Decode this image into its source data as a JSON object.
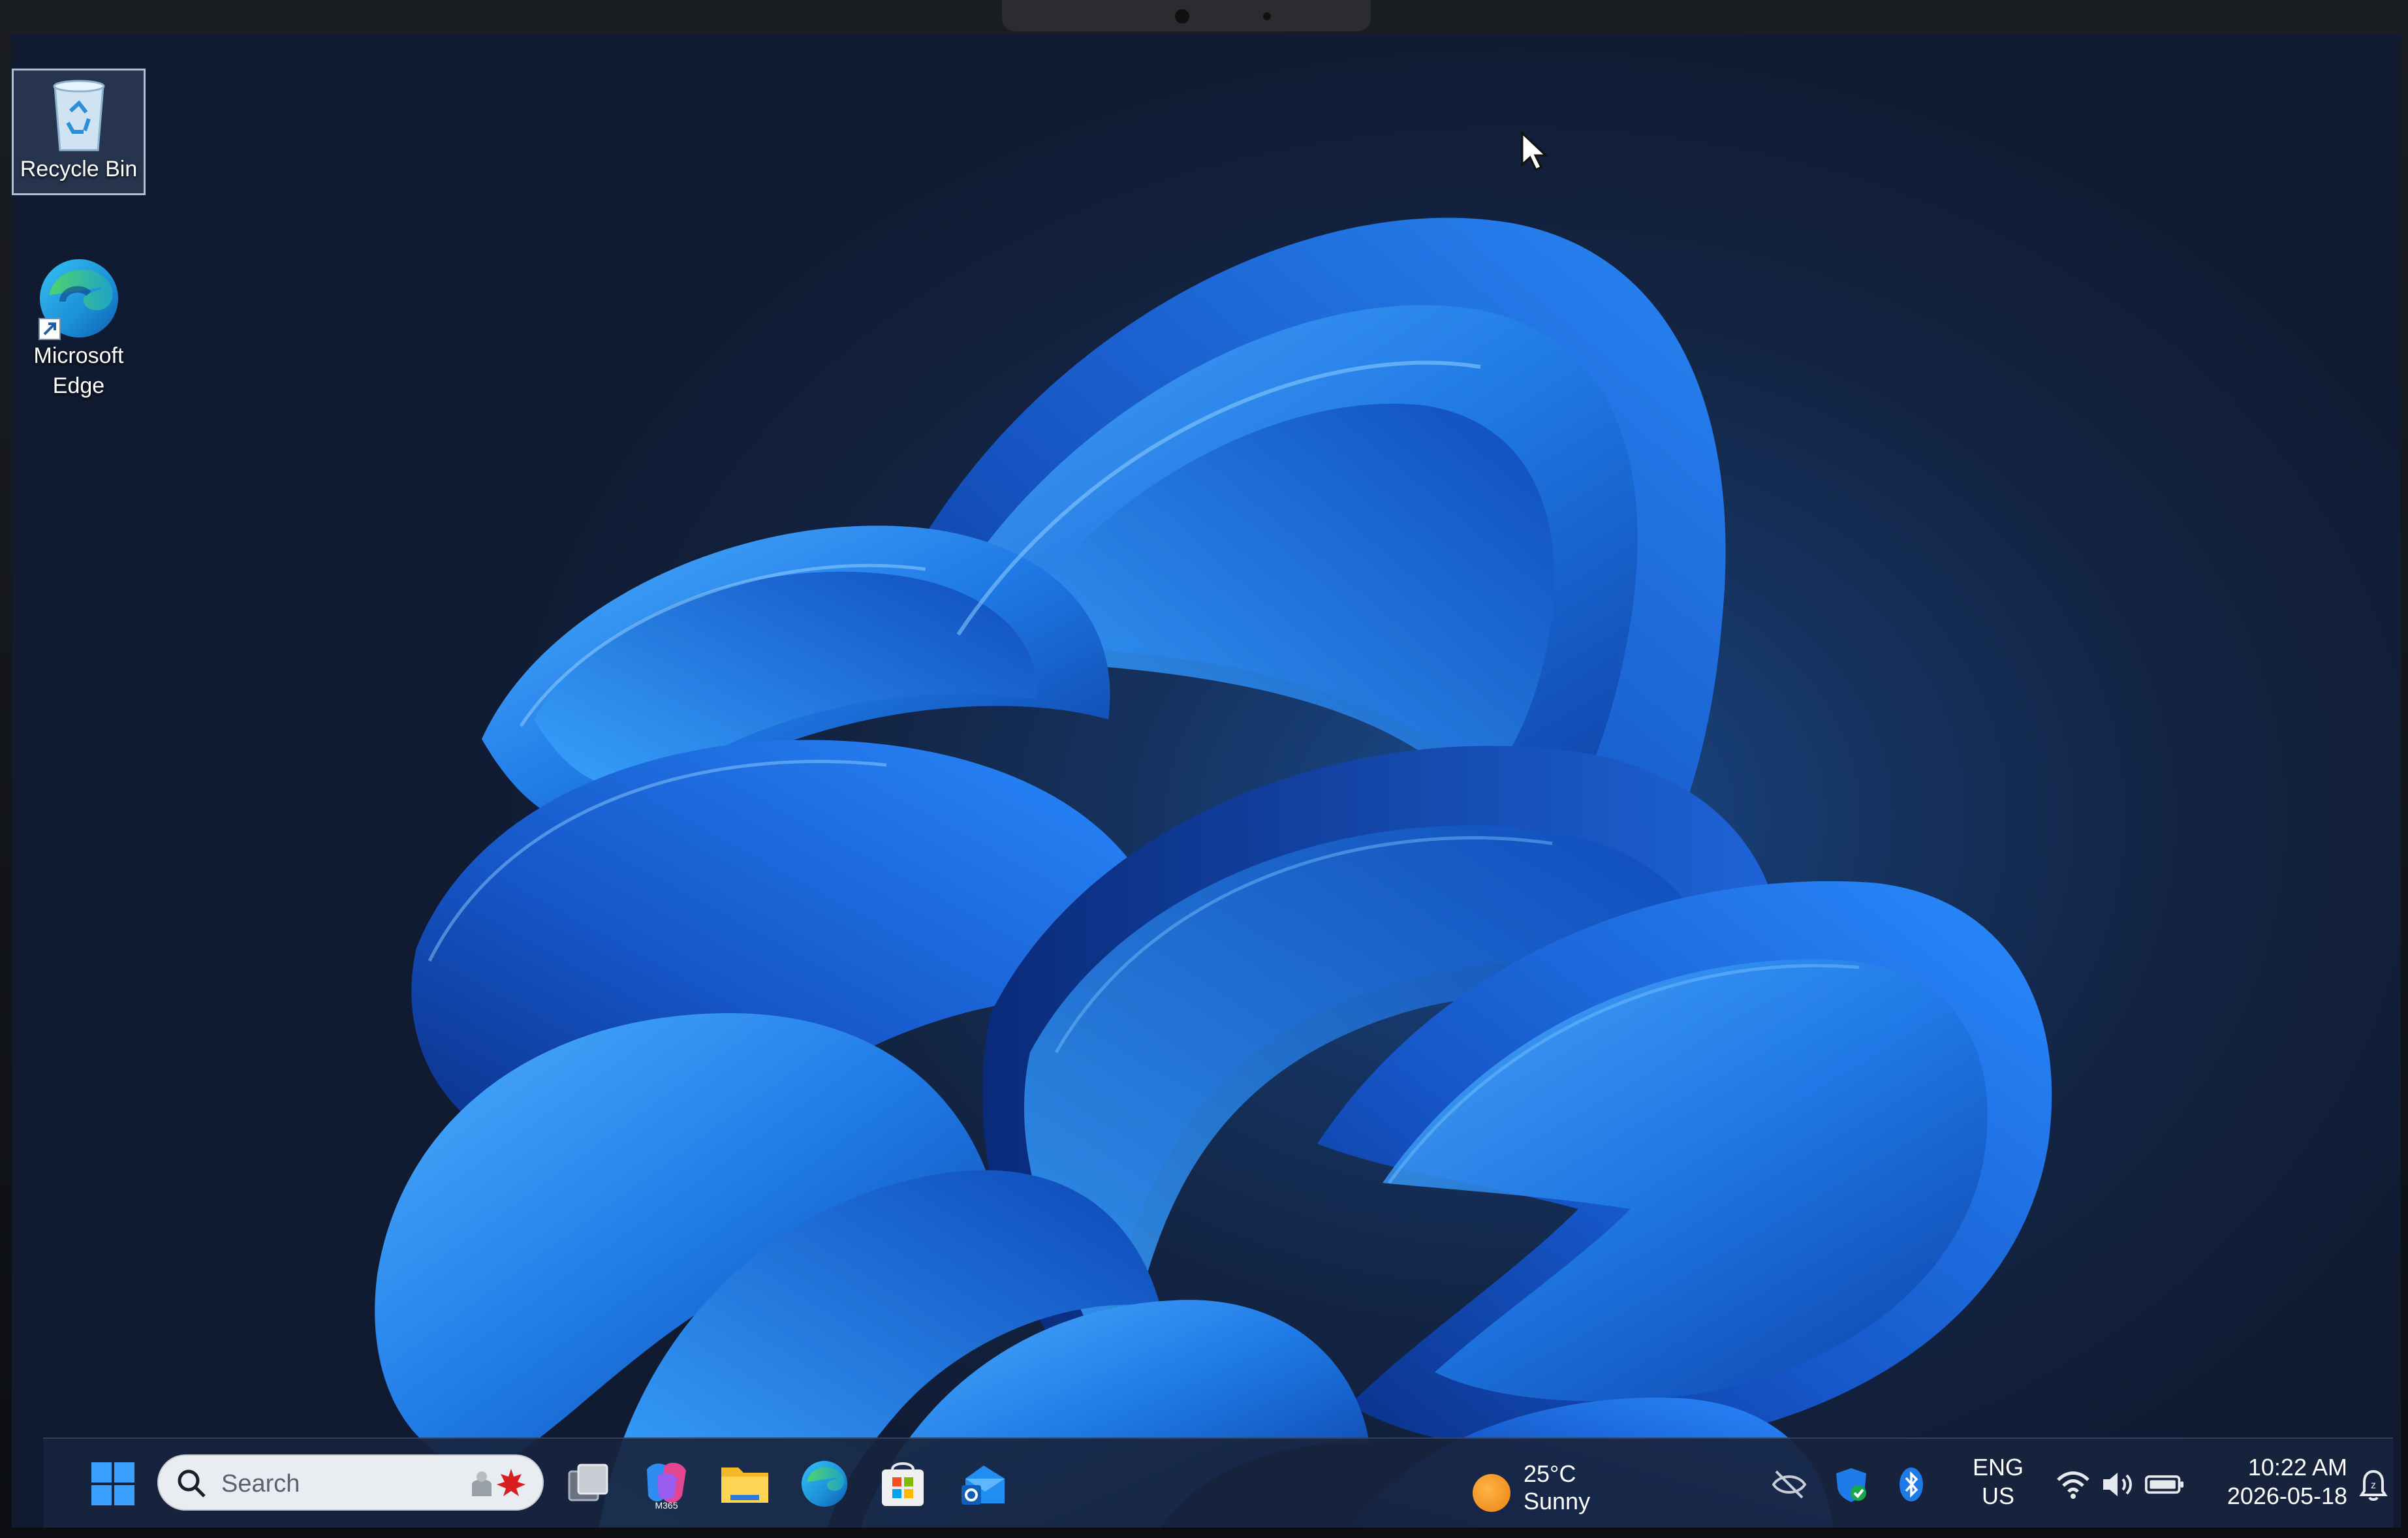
{
  "desktop": {
    "icons": [
      {
        "label": "Recycle Bin",
        "selected": true
      },
      {
        "label_line1": "Microsoft",
        "label_line2": "Edge"
      }
    ]
  },
  "taskbar": {
    "search": {
      "label": "Search"
    },
    "pinned_apps": [
      "start-icon",
      "task-view-icon",
      "m365-copilot-icon",
      "file-explorer-icon",
      "edge-icon",
      "microsoft-store-icon",
      "outlook-icon"
    ],
    "m365_badge": "M365",
    "weather": {
      "temperature": "25°C",
      "condition": "Sunny"
    },
    "tray_icons": [
      "hidden-icons-icon",
      "windows-security-icon",
      "bluetooth-icon",
      "wifi-icon",
      "volume-icon",
      "battery-icon",
      "notifications-icon"
    ],
    "language": {
      "line1": "ENG",
      "line2": "US"
    },
    "clock": {
      "time": "10:22 AM",
      "date": "2026-05-18"
    }
  },
  "colors": {
    "accent": "#1e6fd9",
    "taskbar": "#18243e",
    "wallpaper_bloom": "#1f7ae6"
  }
}
